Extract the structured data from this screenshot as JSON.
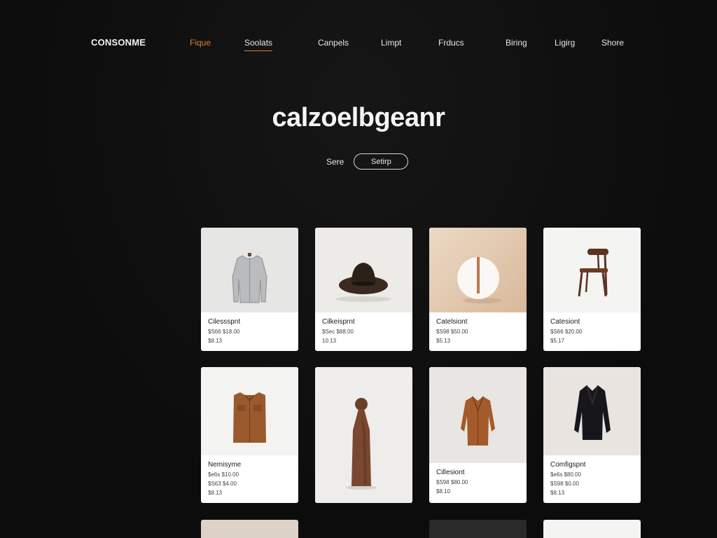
{
  "brand": "CONSONME",
  "nav": [
    {
      "label": "Fique",
      "active": true
    },
    {
      "label": "Soolats",
      "active": false
    },
    {
      "label": "Canpels",
      "active": false
    },
    {
      "label": "Limpt",
      "active": false
    },
    {
      "label": "Frducs",
      "active": false
    },
    {
      "label": "Biring",
      "active": false
    },
    {
      "label": "Ligirg",
      "active": false
    },
    {
      "label": "Shore",
      "active": false
    }
  ],
  "hero": {
    "title": "calzoelbgeanr",
    "save_label": "Sere",
    "setup_label": "Setirp"
  },
  "products": [
    {
      "name": "Cilessspnt",
      "price_a": "$S66 $18.00",
      "price_b": "$8.13",
      "image": "shirt-image"
    },
    {
      "name": "Cilkeisprnt",
      "price_a": "$Sec $88.00",
      "price_b": "10.13",
      "image": "hat-image"
    },
    {
      "name": "Catelsiont",
      "price_a": "$S98 $50.00",
      "price_b": "$5.13",
      "image": "lamp-image"
    },
    {
      "name": "Catesiont",
      "price_a": "$S66 $20.00",
      "price_b": "$5.17",
      "image": "chair-image"
    },
    {
      "name": "Nemisyme",
      "price_a": "$e6s $10.00",
      "price_b": "$S63 $4.00",
      "price_c": "$8.13",
      "image": "jacket-image"
    },
    {
      "name": "",
      "price_a": "",
      "price_b": "",
      "image": "sculpture-image"
    },
    {
      "name": "Cillesiont",
      "price_a": "$S98 $80.00",
      "price_b": "$8.10",
      "image": "coat-image"
    },
    {
      "name": "Comfigspnt",
      "price_a": "$e6s $80.00",
      "price_b": "$S98 $0.00",
      "price_c": "$8.13",
      "image": "blazer-image"
    }
  ]
}
